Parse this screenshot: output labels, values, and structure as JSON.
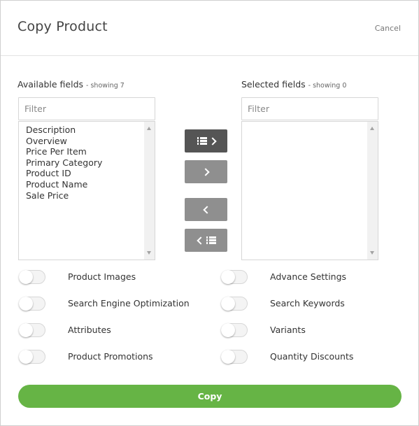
{
  "header": {
    "title": "Copy Product",
    "cancel_label": "Cancel"
  },
  "available": {
    "label": "Available fields",
    "count_text": "- showing 7",
    "filter_placeholder": "Filter",
    "items": [
      "Description",
      "Overview",
      "Price Per Item",
      "Primary Category",
      "Product ID",
      "Product Name",
      "Sale Price"
    ]
  },
  "selected": {
    "label": "Selected fields",
    "count_text": "- showing 0",
    "filter_placeholder": "Filter",
    "items": []
  },
  "move_buttons": {
    "add_all_icon": "list-chevron-right-icon",
    "add_one_icon": "chevron-right-icon",
    "remove_one_icon": "chevron-left-icon",
    "remove_all_icon": "chevron-left-list-icon"
  },
  "toggles": {
    "left": [
      {
        "label": "Product Images",
        "on": false
      },
      {
        "label": "Search Engine Optimization",
        "on": false
      },
      {
        "label": "Attributes",
        "on": false
      },
      {
        "label": "Product Promotions",
        "on": false
      }
    ],
    "right": [
      {
        "label": "Advance Settings",
        "on": false
      },
      {
        "label": "Search Keywords",
        "on": false
      },
      {
        "label": "Variants",
        "on": false
      },
      {
        "label": "Quantity Discounts",
        "on": false
      }
    ]
  },
  "copy_label": "Copy",
  "colors": {
    "copy_button": "#66b445",
    "dark_button": "#555555",
    "gray_button": "#8f8f8f"
  }
}
